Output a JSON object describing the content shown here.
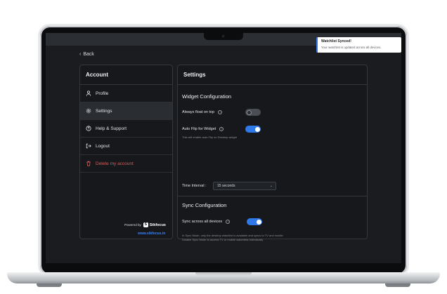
{
  "back_label": "Back",
  "toast": {
    "title": "Watchlist Synced!",
    "message": "Your watchlist is updated across all devices."
  },
  "sidebar": {
    "title": "Account",
    "items": [
      {
        "label": "Profile",
        "icon": "user-icon"
      },
      {
        "label": "Settings",
        "icon": "gear-icon",
        "active": true
      },
      {
        "label": "Help & Support",
        "icon": "question-icon"
      },
      {
        "label": "Logout",
        "icon": "logout-icon"
      },
      {
        "label": "Delete my account",
        "icon": "trash-icon",
        "danger": true
      }
    ],
    "powered_by": "Powered by",
    "brand": "Stkfocus",
    "brand_mark": "S",
    "site": "www.stkfocus.in"
  },
  "settings": {
    "title": "Settings",
    "widget": {
      "title": "Widget Configuration",
      "always_on_top": {
        "label": "Always float on top",
        "enabled": false
      },
      "auto_flip": {
        "label": "Auto Flip for Widget",
        "enabled": true,
        "hint": "This will enable auto-Flip on Desktop widget"
      },
      "time_interval": {
        "label": "Time Interval :",
        "value": "15 seconds"
      }
    },
    "sync": {
      "title": "Sync Configuration",
      "sync_all": {
        "label": "Sync across all devices",
        "enabled": true
      },
      "hint_line1": "In Sync Mode, only the desktop watchlist is available and syncs to TV and mobile.",
      "hint_line2": "Disable Sync Mode to access TV or mobile watchlists individually"
    }
  },
  "colors": {
    "accent": "#2f78e8",
    "danger": "#e05a5a",
    "link": "#3b82f6",
    "background": "#1a1c1f"
  }
}
